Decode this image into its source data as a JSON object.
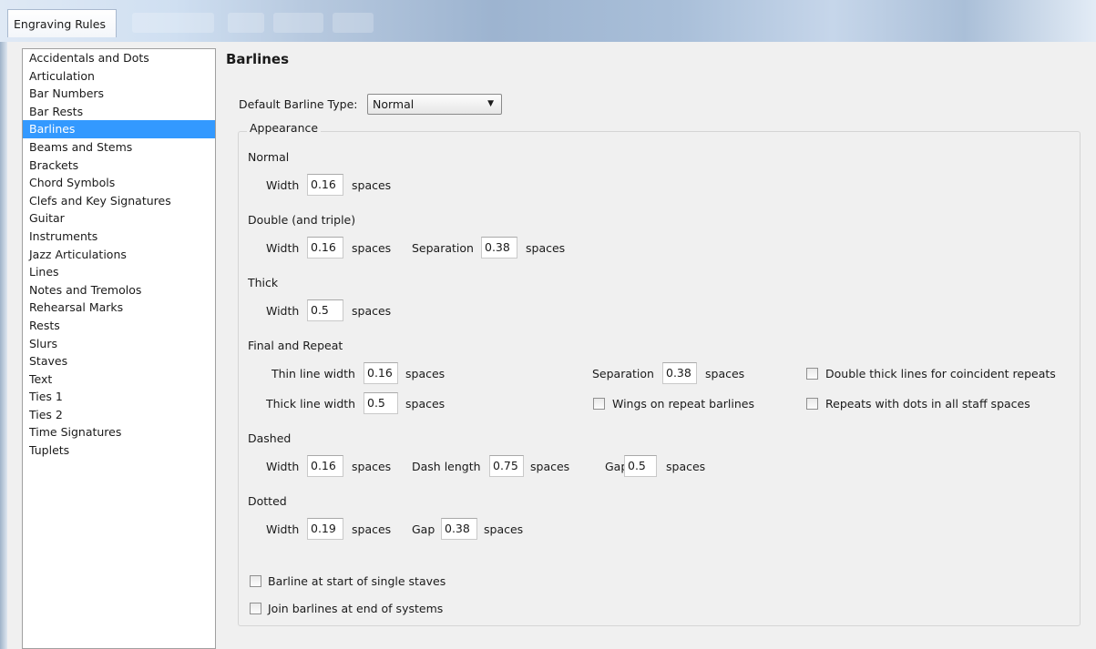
{
  "window": {
    "active_tab": "Engraving Rules"
  },
  "sidebar": {
    "items": [
      {
        "label": "Accidentals and Dots",
        "selected": false
      },
      {
        "label": "Articulation",
        "selected": false
      },
      {
        "label": "Bar Numbers",
        "selected": false
      },
      {
        "label": "Bar Rests",
        "selected": false
      },
      {
        "label": "Barlines",
        "selected": true
      },
      {
        "label": "Beams and Stems",
        "selected": false
      },
      {
        "label": "Brackets",
        "selected": false
      },
      {
        "label": "Chord Symbols",
        "selected": false
      },
      {
        "label": "Clefs and Key Signatures",
        "selected": false
      },
      {
        "label": "Guitar",
        "selected": false
      },
      {
        "label": "Instruments",
        "selected": false
      },
      {
        "label": "Jazz Articulations",
        "selected": false
      },
      {
        "label": "Lines",
        "selected": false
      },
      {
        "label": "Notes and Tremolos",
        "selected": false
      },
      {
        "label": "Rehearsal Marks",
        "selected": false
      },
      {
        "label": "Rests",
        "selected": false
      },
      {
        "label": "Slurs",
        "selected": false
      },
      {
        "label": "Staves",
        "selected": false
      },
      {
        "label": "Text",
        "selected": false
      },
      {
        "label": "Ties 1",
        "selected": false
      },
      {
        "label": "Ties 2",
        "selected": false
      },
      {
        "label": "Time Signatures",
        "selected": false
      },
      {
        "label": "Tuplets",
        "selected": false
      }
    ],
    "selected_color": "#3399ff"
  },
  "main": {
    "title": "Barlines",
    "default_barline": {
      "label": "Default Barline Type:",
      "value": "Normal"
    },
    "appearance_label": "Appearance",
    "units": "spaces",
    "normal": {
      "heading": "Normal",
      "width_label": "Width",
      "width": "0.16"
    },
    "double": {
      "heading": "Double (and triple)",
      "width_label": "Width",
      "width": "0.16",
      "separation_label": "Separation",
      "separation": "0.38"
    },
    "thick": {
      "heading": "Thick",
      "width_label": "Width",
      "width": "0.5"
    },
    "final_repeat": {
      "heading": "Final and Repeat",
      "thin_label": "Thin line width",
      "thin": "0.16",
      "thick_label": "Thick line width",
      "thick": "0.5",
      "separation_label": "Separation",
      "separation": "0.38",
      "wings_label": "Wings on repeat barlines",
      "wings_checked": false,
      "double_thick_label": "Double thick lines for coincident repeats",
      "double_thick_checked": false,
      "repeats_dots_label": "Repeats with dots in all staff spaces",
      "repeats_dots_checked": false
    },
    "dashed": {
      "heading": "Dashed",
      "width_label": "Width",
      "width": "0.16",
      "dash_label": "Dash length",
      "dash": "0.75",
      "gap_label": "Gap",
      "gap": "0.5"
    },
    "dotted": {
      "heading": "Dotted",
      "width_label": "Width",
      "width": "0.19",
      "gap_label": "Gap",
      "gap": "0.38"
    },
    "barline_start_label": "Barline at start of single staves",
    "barline_start_checked": false,
    "join_barlines_label": "Join barlines at end of systems",
    "join_barlines_checked": false
  }
}
